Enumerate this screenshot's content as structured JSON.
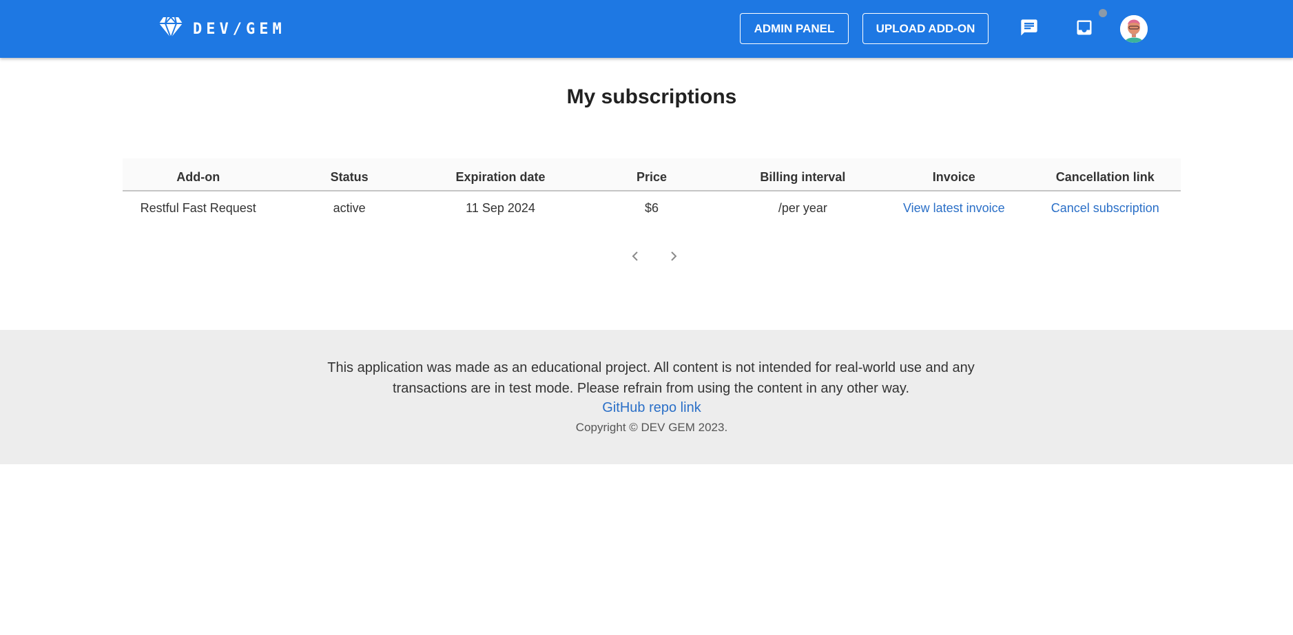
{
  "header": {
    "brand": "DEV/GEM",
    "admin_button": "ADMIN PANEL",
    "upload_button": "UPLOAD ADD-ON",
    "icons": [
      "gem-logo-icon",
      "chat-icon",
      "inbox-icon",
      "avatar"
    ],
    "colors": {
      "bar": "#1e78e3",
      "text": "#ffffff"
    }
  },
  "main": {
    "title": "My subscriptions",
    "table": {
      "headers": [
        "Add-on",
        "Status",
        "Expiration date",
        "Price",
        "Billing interval",
        "Invoice",
        "Cancellation link"
      ],
      "rows": [
        {
          "addon": "Restful Fast Request",
          "status": "active",
          "expiration": "11 Sep 2024",
          "price": "$6",
          "interval": "/per year",
          "invoice": "View latest invoice",
          "cancel": "Cancel subscription"
        }
      ]
    },
    "pagination": {
      "prev_icon": "chevron-left-icon",
      "next_icon": "chevron-right-icon"
    }
  },
  "footer": {
    "text": "This application was made as an educational project. All content is not intended for real-world use and any transactions are in test mode. Please refrain from using the content in any other way.",
    "link": "GitHub repo link",
    "copyright": "Copyright © DEV GEM  2023.",
    "colors": {
      "background": "#ededed",
      "link": "#2a6fc7"
    }
  }
}
